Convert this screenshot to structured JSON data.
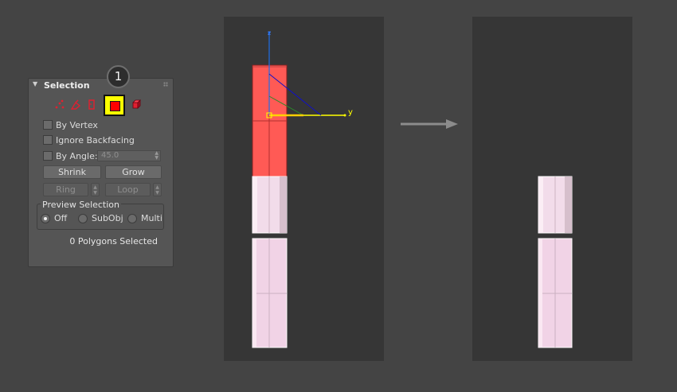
{
  "panel": {
    "title": "Selection",
    "step_badge": "1",
    "icons": [
      "vertex-icon",
      "edge-icon",
      "border-icon",
      "polygon-icon",
      "element-icon"
    ],
    "active_level": "polygon-icon",
    "options": {
      "by_vertex": "By Vertex",
      "ignore_backfacing": "Ignore Backfacing",
      "by_angle": "By Angle:",
      "angle_value": "45.0"
    },
    "buttons": {
      "shrink": "Shrink",
      "grow": "Grow",
      "ring": "Ring",
      "loop": "Loop"
    },
    "preview": {
      "label": "Preview Selection",
      "options": [
        "Off",
        "SubObj",
        "Multi"
      ],
      "selected": "Off"
    },
    "status": "0 Polygons Selected"
  },
  "viewport_left": {
    "axis_labels": {
      "z": "z",
      "y": "y"
    }
  },
  "colors": {
    "background": "#444444",
    "viewport": "#363636",
    "selected_poly": "#ff5a55",
    "mesh": "#f2d8ea",
    "axis_x": "#1010c8",
    "axis_y": "#ffff00",
    "axis_z": "#1e6ee8",
    "active_button": "#ffff00",
    "active_button_inner": "#ff0000"
  }
}
